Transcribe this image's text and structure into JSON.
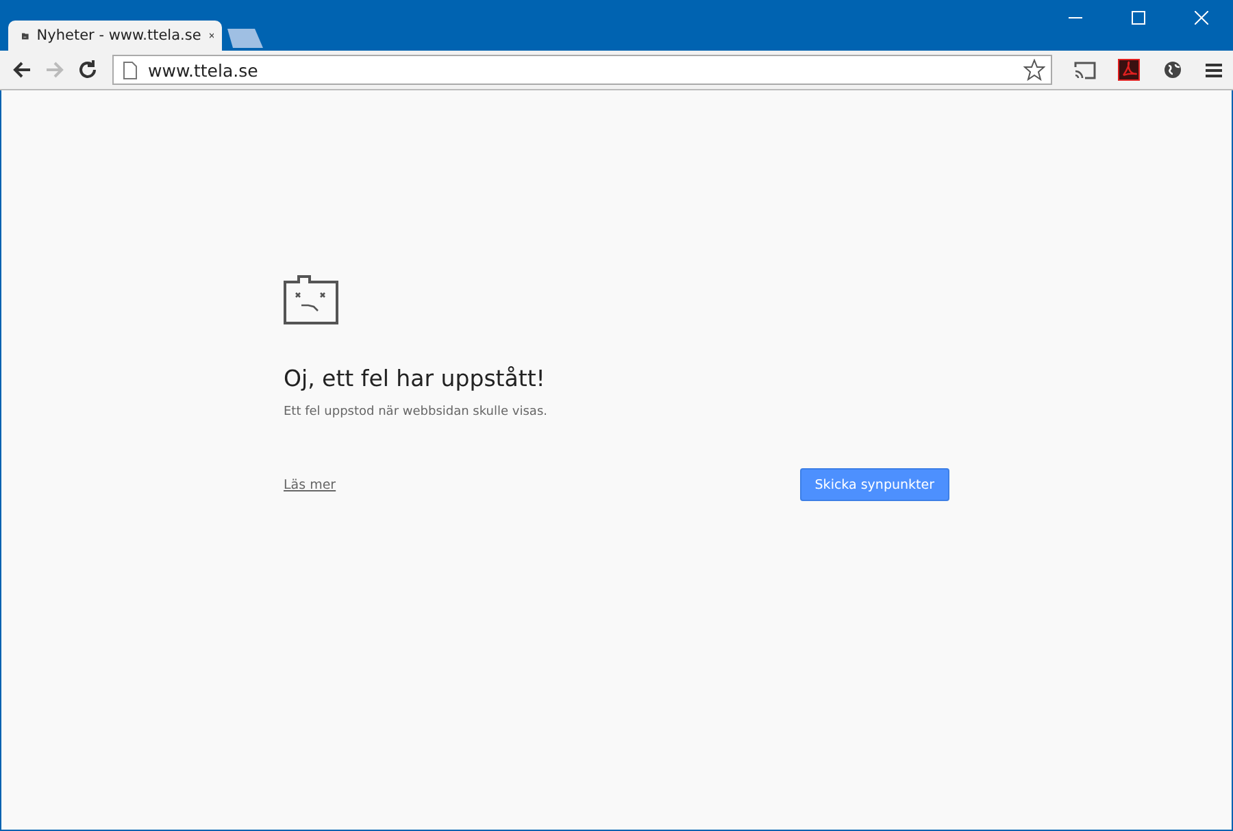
{
  "tabs": [
    {
      "title": "Nyheter - www.ttela.se",
      "selected": true
    }
  ],
  "nav": [
    {
      "kind": "back",
      "disabled": false
    },
    {
      "kind": "forward",
      "disabled": true
    },
    {
      "kind": "reload",
      "disabled": false
    }
  ],
  "address": {
    "value": "www.ttela.se"
  },
  "error": {
    "title": "Oj, ett fel har uppstått!",
    "message": "Ett fel uppstod när webbsidan skulle visas.",
    "link": "Läs mer",
    "button": "Skicka synpunkter"
  }
}
